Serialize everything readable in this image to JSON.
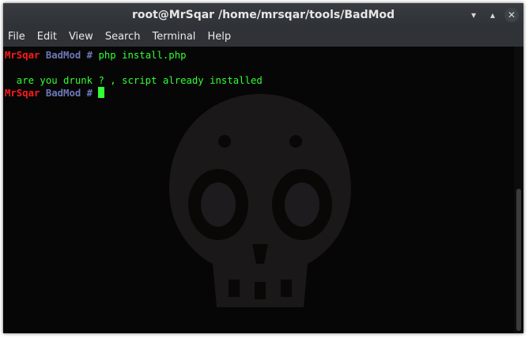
{
  "window": {
    "title": "root@MrSqar /home/mrsqar/tools/BadMod"
  },
  "window_buttons": {
    "minimize": "▾",
    "maximize": "▴",
    "close": "✕"
  },
  "menu": [
    "File",
    "Edit",
    "View",
    "Search",
    "Terminal",
    "Help"
  ],
  "terminal": {
    "prompt_user": "MrSqar",
    "prompt_host": "BadMod",
    "prompt_symbol": "#",
    "command": "php install.php",
    "output": "  are you drunk ? , script already installed"
  },
  "colors": {
    "prompt_user": "#ff1a1a",
    "prompt_host": "#6c79b8",
    "text": "#33ff33",
    "background": "#060606",
    "titlebar": "#2f3337"
  },
  "icons": {
    "background_art": "skull-icon"
  }
}
